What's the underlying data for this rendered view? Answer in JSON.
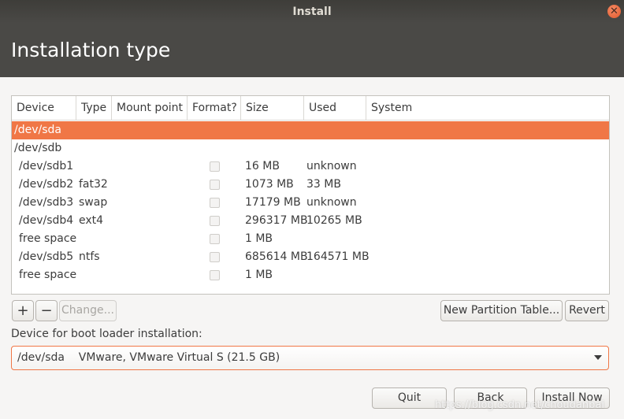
{
  "window": {
    "title": "Install",
    "close_glyph": "✕"
  },
  "page_title": "Installation type",
  "table": {
    "columns": [
      "Device",
      "Type",
      "Mount point",
      "Format?",
      "Size",
      "Used",
      "System"
    ],
    "rows": [
      {
        "device": "/dev/sda",
        "type": "",
        "mount": "",
        "format": false,
        "size": "",
        "used": "",
        "system": "",
        "selected": true,
        "is_disk": true
      },
      {
        "device": "/dev/sdb",
        "type": "",
        "mount": "",
        "format": false,
        "size": "",
        "used": "",
        "system": "",
        "selected": false,
        "is_disk": true
      },
      {
        "device": "/dev/sdb1",
        "type": "",
        "mount": "",
        "format": false,
        "size": "16 MB",
        "used": "unknown",
        "system": "",
        "selected": false,
        "is_disk": false
      },
      {
        "device": "/dev/sdb2",
        "type": "fat32",
        "mount": "",
        "format": false,
        "size": "1073 MB",
        "used": "33 MB",
        "system": "",
        "selected": false,
        "is_disk": false
      },
      {
        "device": "/dev/sdb3",
        "type": "swap",
        "mount": "",
        "format": false,
        "size": "17179 MB",
        "used": "unknown",
        "system": "",
        "selected": false,
        "is_disk": false
      },
      {
        "device": "/dev/sdb4",
        "type": "ext4",
        "mount": "",
        "format": false,
        "size": "296317 MB",
        "used": "10265 MB",
        "system": "",
        "selected": false,
        "is_disk": false
      },
      {
        "device": "free space",
        "type": "",
        "mount": "",
        "format": false,
        "size": "1 MB",
        "used": "",
        "system": "",
        "selected": false,
        "is_disk": false
      },
      {
        "device": "/dev/sdb5",
        "type": "ntfs",
        "mount": "",
        "format": false,
        "size": "685614 MB",
        "used": "164571 MB",
        "system": "",
        "selected": false,
        "is_disk": false
      },
      {
        "device": "free space",
        "type": "",
        "mount": "",
        "format": false,
        "size": "1 MB",
        "used": "",
        "system": "",
        "selected": false,
        "is_disk": false
      }
    ]
  },
  "toolbar": {
    "add_label": "+",
    "remove_label": "−",
    "change_label": "Change...",
    "new_table_label": "New Partition Table...",
    "revert_label": "Revert"
  },
  "bootloader": {
    "label": "Device for boot loader installation:",
    "selected": "/dev/sda    VMware, VMware Virtual S (21.5 GB)"
  },
  "footer": {
    "quit_label": "Quit",
    "back_label": "Back",
    "install_label": "Install Now"
  },
  "watermark": "https://blog.csdn.net/choudanbai",
  "colors": {
    "accent": "#f07746",
    "titlebar": "#4a4946",
    "close": "#e2592c"
  }
}
